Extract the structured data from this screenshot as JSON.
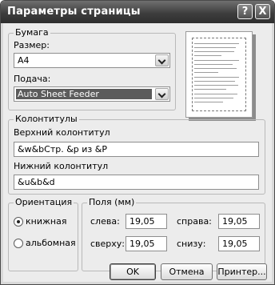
{
  "window": {
    "title": "Параметры страницы"
  },
  "titlebar_buttons": {
    "help": "?",
    "close": "X"
  },
  "paper": {
    "legend": "Бумага",
    "size_label": "Размер:",
    "size_value": "A4",
    "source_label": "Подача:",
    "source_value": "Auto Sheet Feeder"
  },
  "headers_footers": {
    "legend": "Колонтитулы",
    "header_label": "Верхний колонтитул",
    "header_value": "&w&bСтр. &p из &P",
    "footer_label": "Нижний колонтитул",
    "footer_value": "&u&b&d"
  },
  "orientation": {
    "legend": "Ориентация",
    "portrait": "книжная",
    "landscape": "альбомная",
    "selected": "portrait"
  },
  "margins": {
    "legend": "Поля (мм)",
    "left_label": "слева:",
    "left_value": "19,05",
    "right_label": "справа:",
    "right_value": "19,05",
    "top_label": "сверху:",
    "top_value": "19,05",
    "bottom_label": "снизу:",
    "bottom_value": "19,05"
  },
  "buttons": {
    "ok": "OK",
    "cancel": "Отмена",
    "printer": "Принтер..."
  }
}
